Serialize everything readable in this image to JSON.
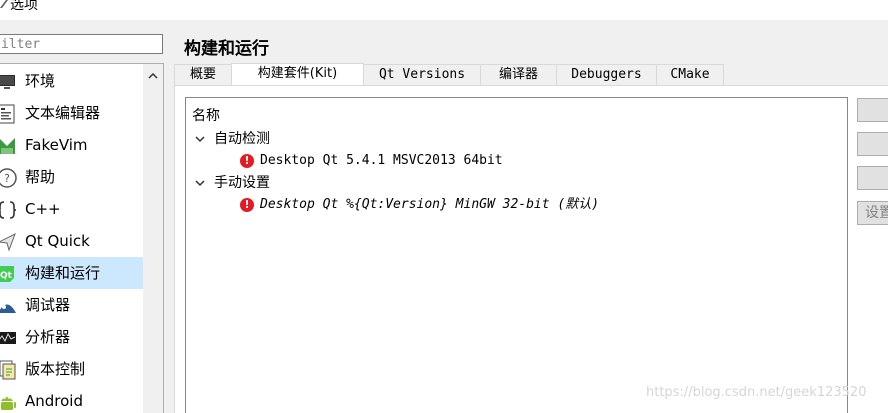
{
  "window": {
    "title": "选项"
  },
  "filter": {
    "placeholder": "ilter",
    "value": ""
  },
  "sidebar": {
    "items": [
      {
        "label": "环境",
        "icon": "monitor-icon"
      },
      {
        "label": "文本编辑器",
        "icon": "text-editor-icon"
      },
      {
        "label": "FakeVim",
        "icon": "fakevim-icon"
      },
      {
        "label": "帮助",
        "icon": "help-icon"
      },
      {
        "label": "C++",
        "icon": "cpp-icon"
      },
      {
        "label": "Qt Quick",
        "icon": "qt-quick-icon"
      },
      {
        "label": "构建和运行",
        "icon": "build-run-icon",
        "selected": true
      },
      {
        "label": "调试器",
        "icon": "debugger-icon"
      },
      {
        "label": "分析器",
        "icon": "analyzer-icon"
      },
      {
        "label": "版本控制",
        "icon": "version-control-icon"
      },
      {
        "label": "Android",
        "icon": "android-icon"
      }
    ]
  },
  "main": {
    "title": "构建和运行",
    "tabs": [
      {
        "label": "概要",
        "active": false
      },
      {
        "label": "构建套件(Kit)",
        "active": true
      },
      {
        "label": "Qt Versions",
        "active": false
      },
      {
        "label": "编译器",
        "active": false
      },
      {
        "label": "Debuggers",
        "active": false
      },
      {
        "label": "CMake",
        "active": false
      }
    ],
    "tree": {
      "header": "名称",
      "groups": [
        {
          "label": "自动检测",
          "kits": [
            {
              "name": "Desktop Qt 5.4.1 MSVC2013 64bit",
              "status": "error"
            }
          ]
        },
        {
          "label": "手动设置",
          "kits": [
            {
              "name": "Desktop Qt %{Qt:Version} MinGW 32-bit (默认)",
              "status": "error"
            }
          ]
        }
      ]
    },
    "buttons": [
      "",
      "",
      "",
      "设置"
    ]
  },
  "watermark": "https://blog.csdn.net/geek123520",
  "colors": {
    "selection": "#cce8ff",
    "error": "#e51b24",
    "tree_border": "#828790"
  }
}
